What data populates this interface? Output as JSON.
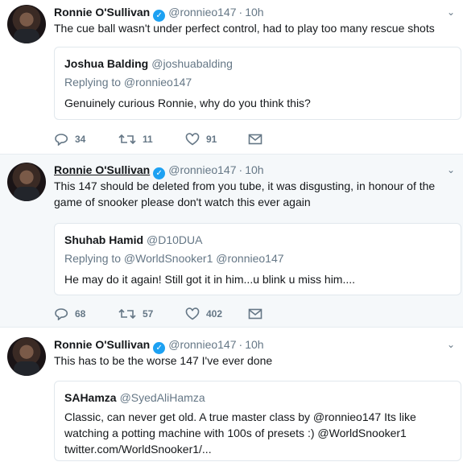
{
  "tweets": [
    {
      "author": "Ronnie O'Sullivan",
      "handle": "@ronnieo147",
      "sep": "·",
      "time": "10h",
      "text": "The cue ball wasn't under perfect control, had to play too many rescue shots",
      "quote": {
        "name": "Joshua Balding",
        "handle": "@joshuabalding",
        "replying": "Replying to @ronnieo147",
        "text": "Genuinely curious Ronnie, why do you think this?"
      },
      "replies": "34",
      "retweets": "11",
      "likes": "91"
    },
    {
      "author": "Ronnie O'Sullivan",
      "handle": "@ronnieo147",
      "sep": "·",
      "time": "10h",
      "text": "This 147 should be deleted from you tube, it was disgusting, in honour of the game of snooker please don't watch this ever again",
      "quote": {
        "name": "Shuhab Hamid",
        "handle": "@D10DUA",
        "replying": "Replying to @WorldSnooker1 @ronnieo147",
        "text": "He may do it again! Still got it in him...u blink u miss him...."
      },
      "replies": "68",
      "retweets": "57",
      "likes": "402"
    },
    {
      "author": "Ronnie O'Sullivan",
      "handle": "@ronnieo147",
      "sep": "·",
      "time": "10h",
      "text": "This has to be the worse 147 I've ever done",
      "quote": {
        "name": "SAHamza",
        "handle": "@SyedAliHamza",
        "text": "Classic, can never get old. A true master class by @ronnieo147 Its like watching a potting machine with 100s of presets :) @WorldSnooker1 twitter.com/WorldSnooker1/..."
      }
    }
  ],
  "icons": {
    "verified": "verified-badge-icon",
    "caret": "chevron-down-icon",
    "reply": "reply-icon",
    "retweet": "retweet-icon",
    "like": "heart-icon",
    "dm": "envelope-icon"
  },
  "colors": {
    "accent": "#1da1f2",
    "secondary_text": "#657786",
    "hover_bg": "#f5f8fa",
    "border": "#e1e8ed"
  }
}
